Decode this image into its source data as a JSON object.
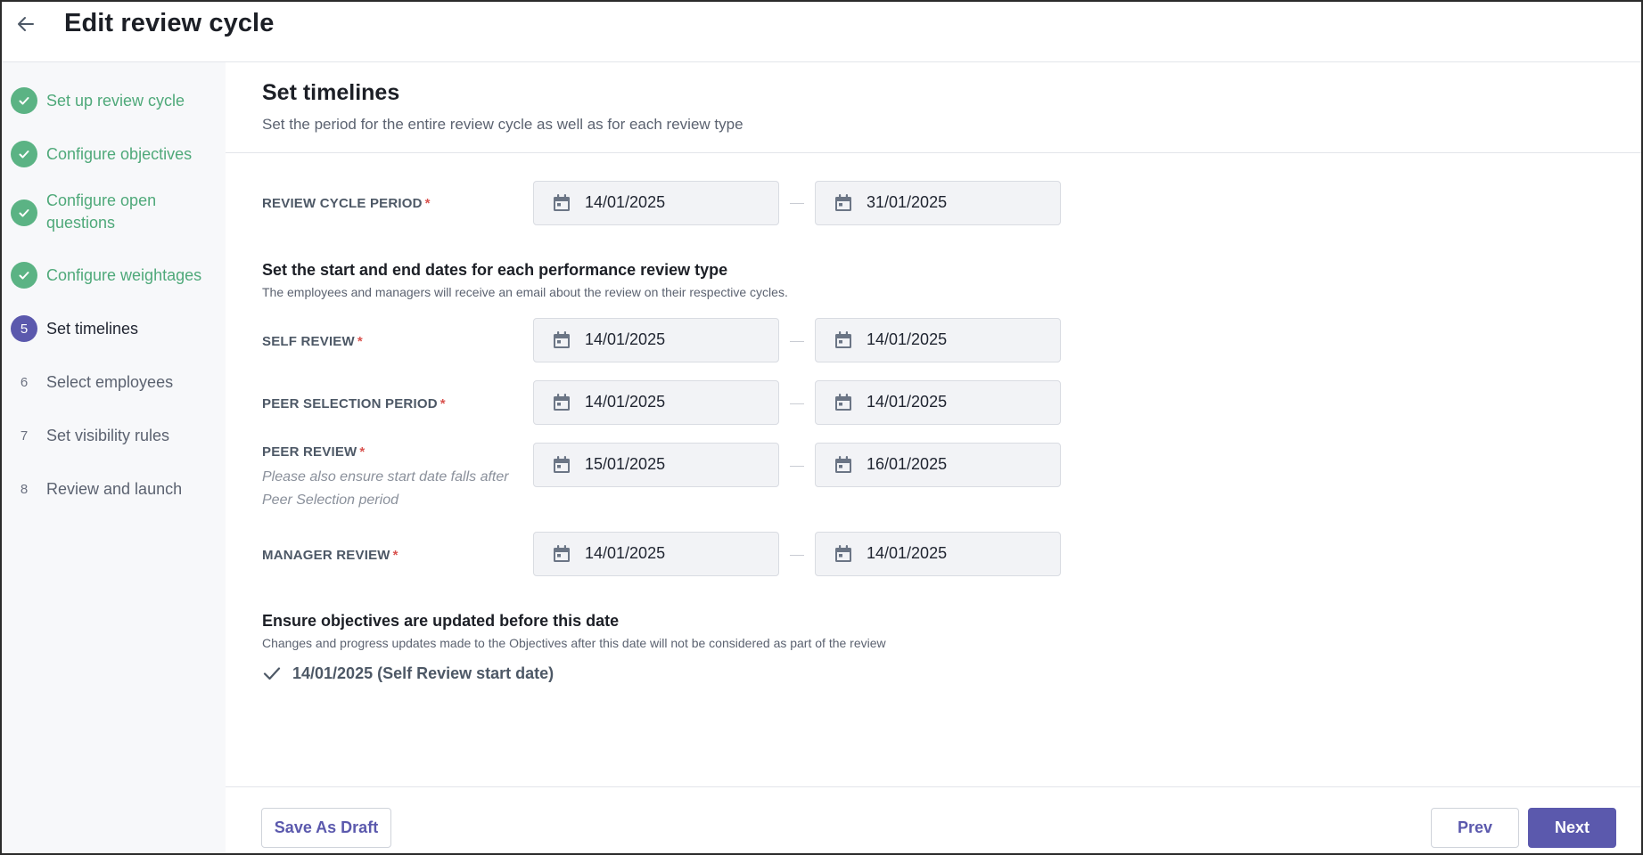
{
  "header": {
    "title": "Edit review cycle",
    "back_icon": "arrow-left-icon"
  },
  "sidebar": {
    "steps": [
      {
        "label": "Set up review cycle",
        "state": "done"
      },
      {
        "label": "Configure objectives",
        "state": "done"
      },
      {
        "label": "Configure open questions",
        "state": "done"
      },
      {
        "label": "Configure weightages",
        "state": "done"
      },
      {
        "label": "Set timelines",
        "state": "active",
        "number": "5"
      },
      {
        "label": "Select employees",
        "state": "pending",
        "number": "6"
      },
      {
        "label": "Set visibility rules",
        "state": "pending",
        "number": "7"
      },
      {
        "label": "Review and launch",
        "state": "pending",
        "number": "8"
      }
    ]
  },
  "main": {
    "title": "Set timelines",
    "subtitle": "Set the period for the entire review cycle as well as for each review type",
    "review_cycle_period": {
      "label": "REVIEW CYCLE PERIOD",
      "required": "*",
      "start": "14/01/2025",
      "end": "31/01/2025"
    },
    "per_type": {
      "title": "Set the start and end dates for each performance review type",
      "description": "The employees and managers will receive an email about the review on their respective cycles."
    },
    "self_review": {
      "label": "SELF REVIEW",
      "required": "*",
      "start": "14/01/2025",
      "end": "14/01/2025"
    },
    "peer_selection": {
      "label": "PEER SELECTION PERIOD",
      "required": "*",
      "start": "14/01/2025",
      "end": "14/01/2025"
    },
    "peer_review": {
      "label": "PEER REVIEW",
      "required": "*",
      "hint": "Please also ensure start date falls after Peer Selection period",
      "start": "15/01/2025",
      "end": "16/01/2025"
    },
    "manager_review": {
      "label": "MANAGER REVIEW",
      "required": "*",
      "start": "14/01/2025",
      "end": "14/01/2025"
    },
    "objectives_cutoff": {
      "title": "Ensure objectives are updated before this date",
      "description": "Changes and progress updates made to the Objectives after this date will not be considered as part of the review",
      "value": "14/01/2025 (Self Review start date)"
    }
  },
  "footer": {
    "save_draft": "Save As Draft",
    "prev": "Prev",
    "next": "Next"
  },
  "colors": {
    "accent": "#5b59ad",
    "done": "#5bb384",
    "required": "#d9534f"
  }
}
